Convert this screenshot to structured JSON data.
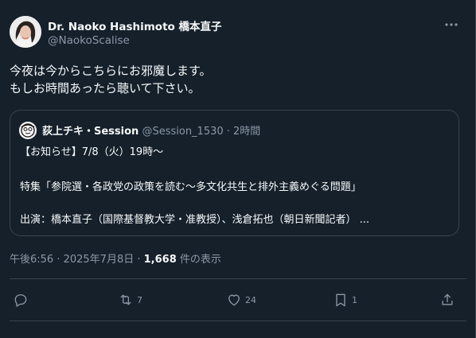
{
  "tweet": {
    "author_name": "Dr. Naoko Hashimoto 橋本直子",
    "author_handle": "@NaokoScalise",
    "text_line1": "今夜は今からこちらにお邪魔します。",
    "text_line2": "もしお時間あったら聴いて下さい。",
    "quote": {
      "name": "荻上チキ・Session",
      "handle_time": "@Session_1530 · 2時間",
      "line1": "【お知らせ】7/8（火）19時～",
      "line2": "特集「参院選・各政党の政策を読む～多文化共生と排外主義めぐる問題」",
      "line3": "出演：橋本直子（国際基督教大学・准教授）、浅倉拓也（朝日新聞記者） ..."
    },
    "timestamp": "午後6:56 · 2025年7月8日 · ",
    "views_count": "1,668",
    "views_label": " 件の表示"
  },
  "actions": {
    "reply_count": "",
    "retweet_count": "7",
    "like_count": "24",
    "bookmark_count": "1"
  },
  "icons": {
    "more": "more-icon",
    "reply": "reply-icon",
    "retweet": "retweet-icon",
    "like": "heart-icon",
    "bookmark": "bookmark-icon",
    "share": "share-icon"
  },
  "colors": {
    "background": "#15202b",
    "text": "#f7f9f9",
    "muted": "#8b98a5",
    "border": "#38444d"
  }
}
